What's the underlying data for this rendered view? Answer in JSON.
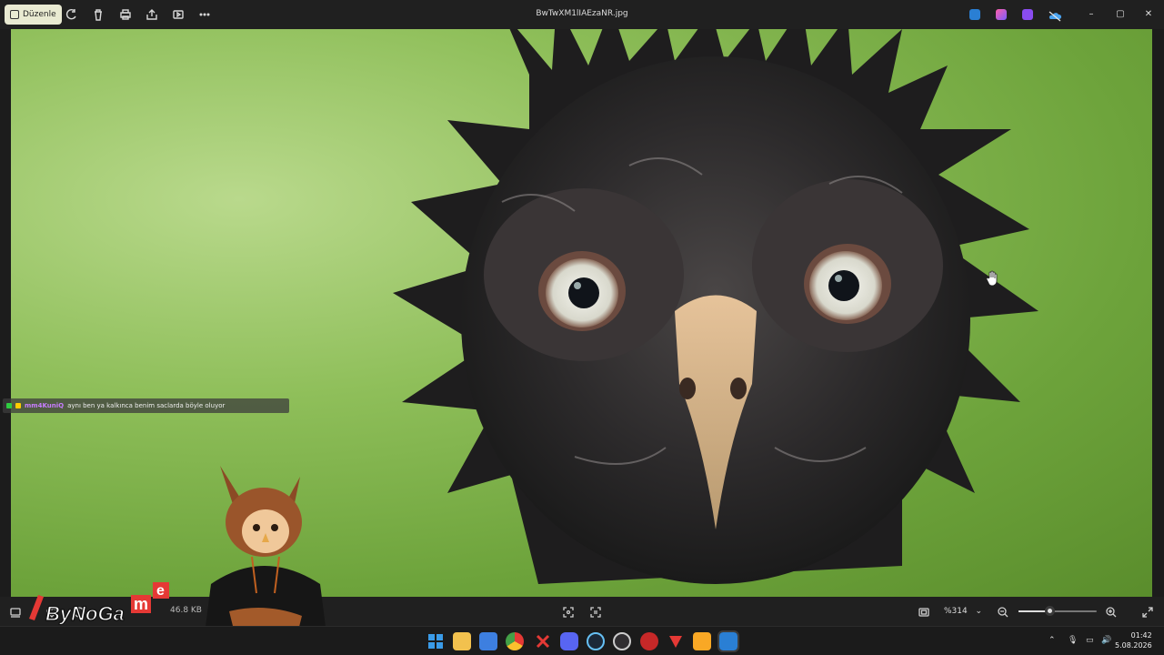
{
  "titlebar": {
    "edit_label": "Düzenle",
    "filename": "BwTwXM1lIAEzaNR.jpg",
    "tools": [
      "rotate-icon",
      "delete-icon",
      "print-icon",
      "share-icon",
      "slideshow-icon",
      "more-icon"
    ],
    "window_controls": [
      "–",
      "▢",
      "✕"
    ]
  },
  "statusbar": {
    "file_size": "46.8 KB",
    "zoom_value": "%314",
    "zoom_level": 0.4
  },
  "chat": {
    "user": "mm4KuniQ",
    "message": "aynı ben ya kalkınca benim saclarda böyle oluyor"
  },
  "overlay": {
    "logo_text": "ByNoGa",
    "logo_accent": "me"
  },
  "taskbar": {
    "time": "01:42",
    "date": "5.08.2026",
    "apps": [
      "start-icon",
      "file-explorer-icon",
      "store-icon",
      "chrome-icon",
      "close-app-icon",
      "discord-icon",
      "steam-icon",
      "obs-icon",
      "record-icon",
      "game-icon",
      "utility-icon",
      "photos-icon"
    ]
  },
  "colors": {
    "background_green": "#8fbf5a",
    "accent_edit": "#e9ead2",
    "chat_user": "#c77dff"
  }
}
